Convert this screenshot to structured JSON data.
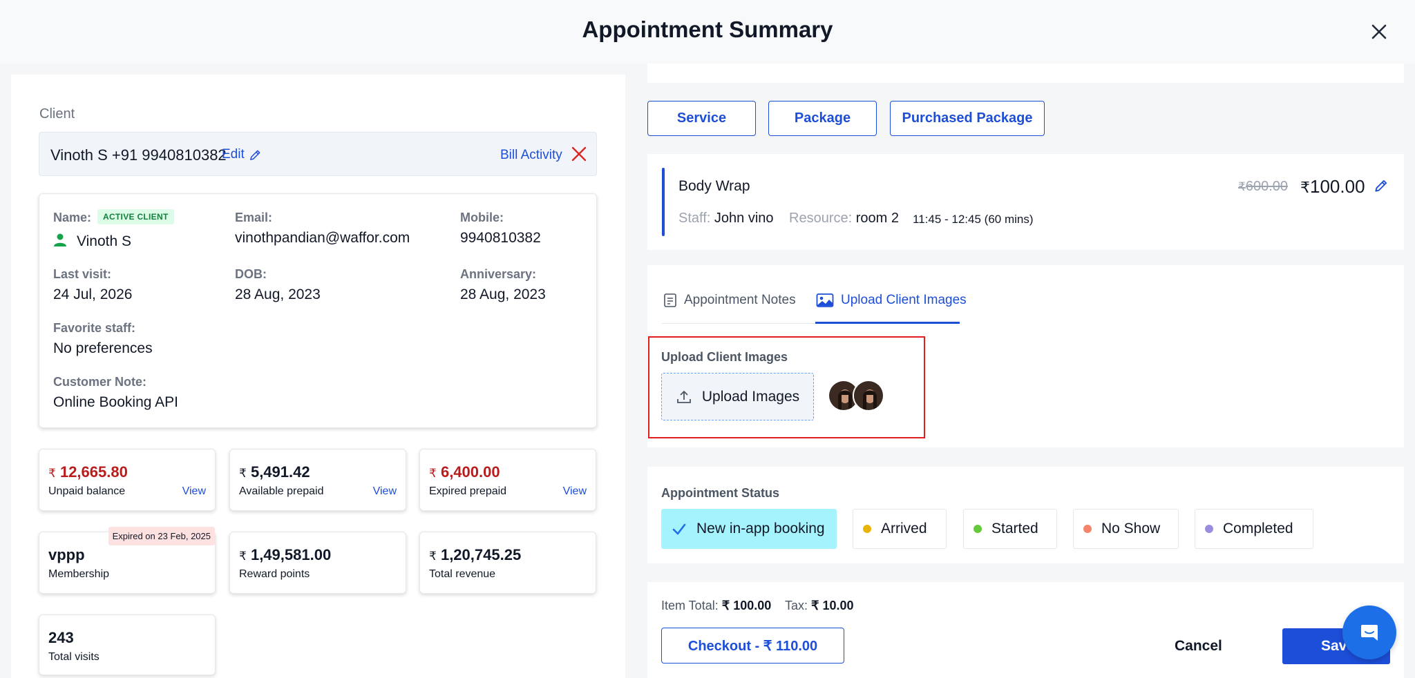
{
  "header": {
    "title": "Appointment Summary"
  },
  "client_section": {
    "label": "Client",
    "bar_name": "Vinoth S +91 9940810382",
    "edit": "Edit",
    "bill_activity": "Bill Activity"
  },
  "client_details": {
    "name_label": "Name:",
    "status_badge": "ACTIVE CLIENT",
    "name": "Vinoth S",
    "email_label": "Email:",
    "email": "vinothpandian@waffor.com",
    "mobile_label": "Mobile:",
    "mobile": "9940810382",
    "last_visit_label": "Last visit:",
    "last_visit": "24 Jul, 2026",
    "dob_label": "DOB:",
    "dob": "28 Aug, 2023",
    "anniversary_label": "Anniversary:",
    "anniversary": "28 Aug, 2023",
    "favorite_staff_label": "Favorite staff:",
    "favorite_staff": "No preferences",
    "customer_note_label": "Customer Note:",
    "customer_note": "Online Booking API"
  },
  "stats": {
    "unpaid": {
      "value": "12,665.80",
      "label": "Unpaid balance",
      "view": "View"
    },
    "prepaid": {
      "value": "5,491.42",
      "label": "Available prepaid",
      "view": "View"
    },
    "expired": {
      "value": "6,400.00",
      "label": "Expired prepaid",
      "view": "View"
    },
    "membership": {
      "value": "vppp",
      "label": "Membership",
      "tag": "Expired on 23 Feb, 2025"
    },
    "reward": {
      "value": "1,49,581.00",
      "label": "Reward points"
    },
    "revenue": {
      "value": "1,20,745.25",
      "label": "Total revenue"
    },
    "visits": {
      "value": "243",
      "label": "Total visits"
    },
    "currency": "₹"
  },
  "tabs": {
    "service": "Service",
    "package": "Package",
    "purchased": "Purchased Package"
  },
  "service": {
    "name": "Body Wrap",
    "old_price": "600.00",
    "new_price": "100.00",
    "staff_label": "Staff:",
    "staff": "John vino",
    "resource_label": "Resource:",
    "resource": "room 2",
    "time": "11:45 - 12:45 (60 mins)"
  },
  "notes_tabs": {
    "notes": "Appointment Notes",
    "upload": "Upload Client Images"
  },
  "upload": {
    "label": "Upload Client Images",
    "button": "Upload Images"
  },
  "status": {
    "label": "Appointment Status",
    "options": [
      "New in-app booking",
      "Arrived",
      "Started",
      "No Show",
      "Completed"
    ],
    "colors": [
      "#1d6fe8",
      "#eab308",
      "#65c93a",
      "#f4846a",
      "#9b8ce0"
    ]
  },
  "footer": {
    "item_total_label": "Item Total:",
    "item_total": "100.00",
    "tax_label": "Tax:",
    "tax": "10.00",
    "checkout": "Checkout - ₹ 110.00",
    "cancel": "Cancel",
    "save": "Save"
  }
}
